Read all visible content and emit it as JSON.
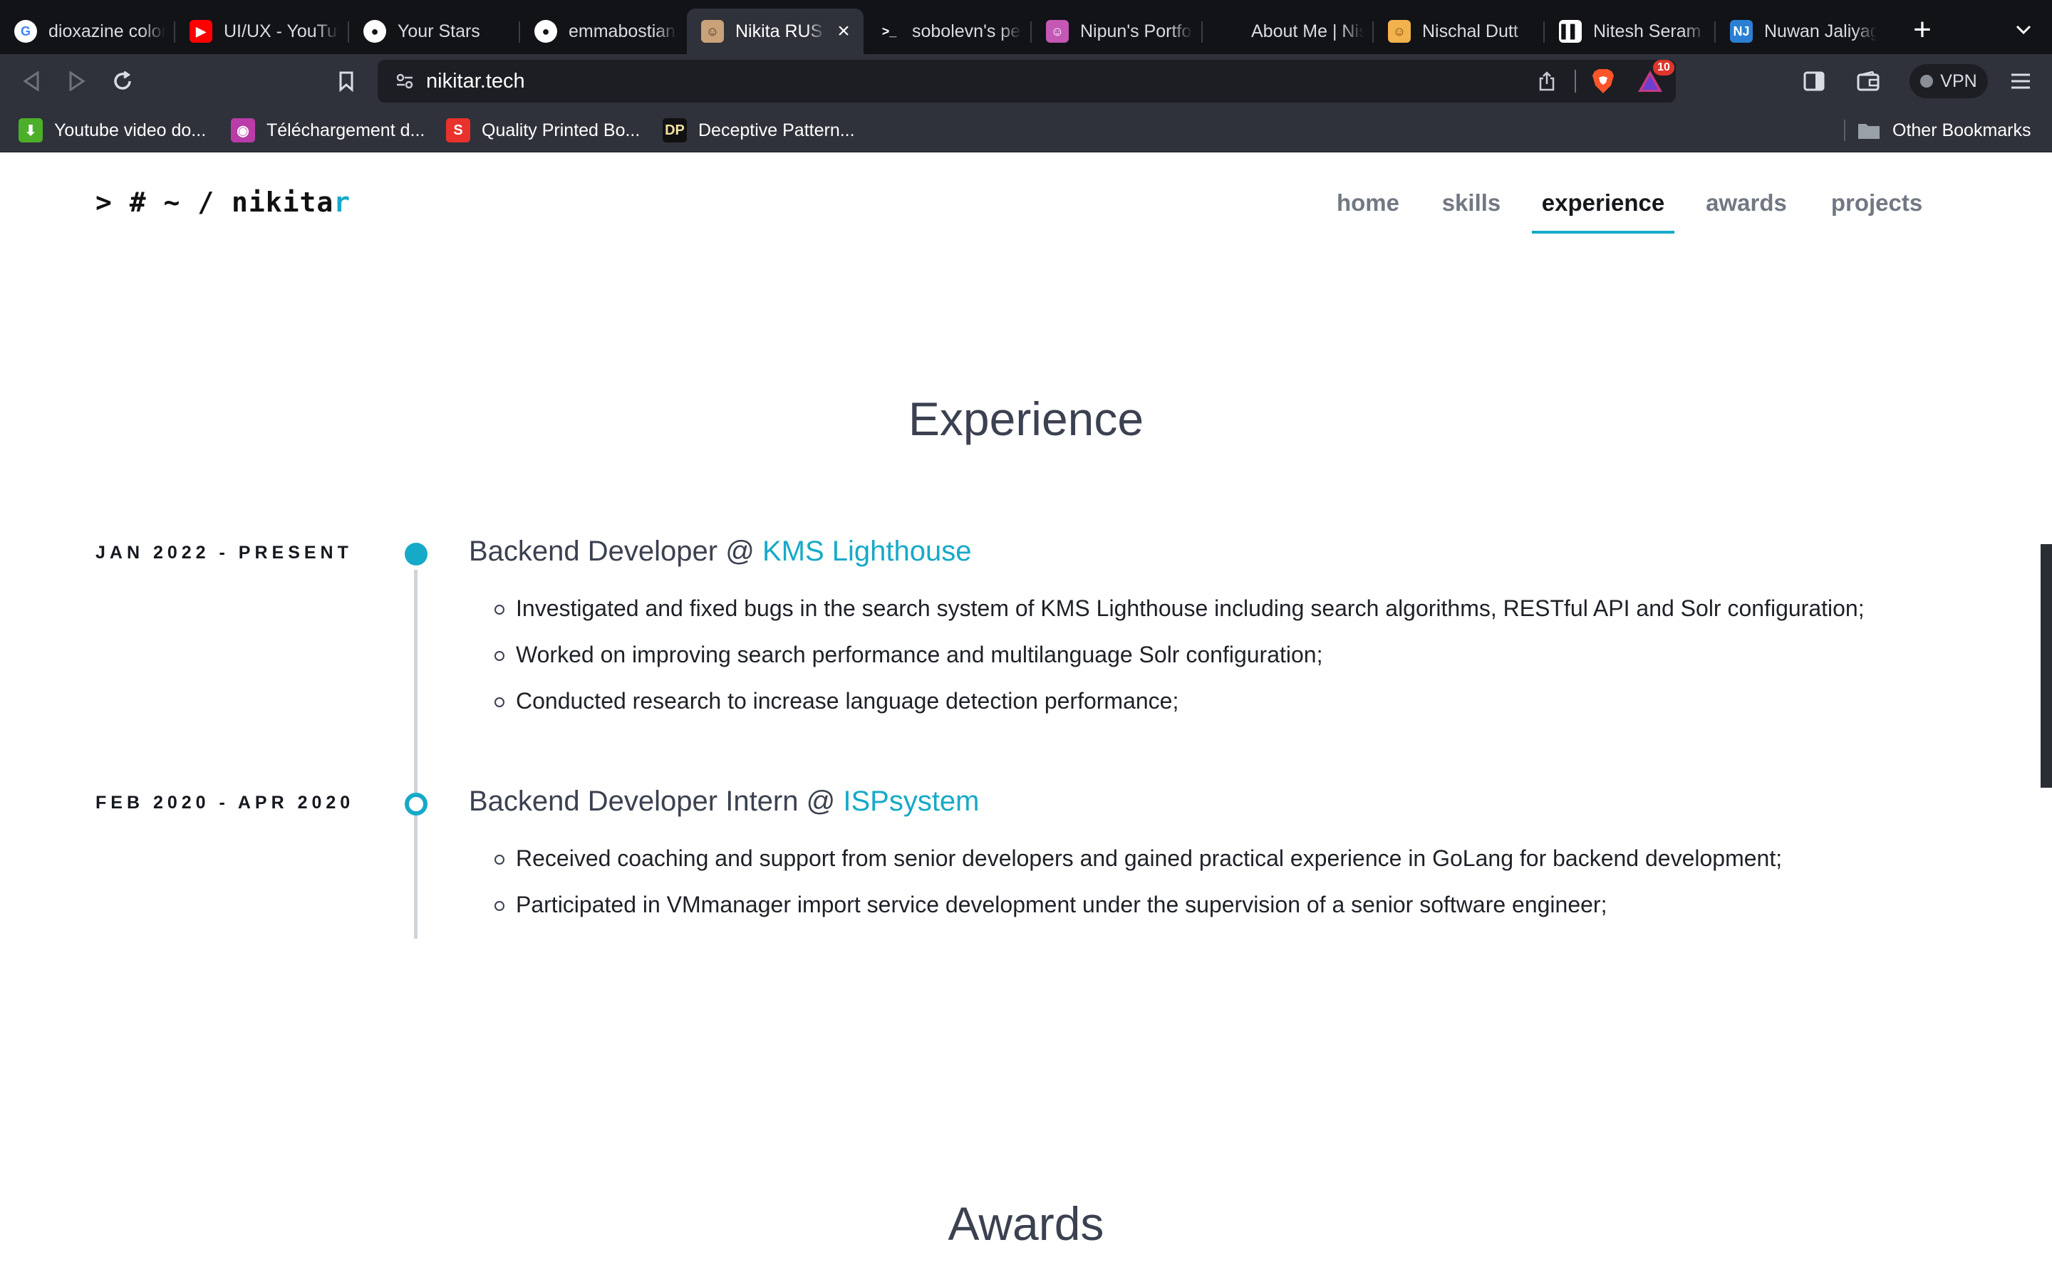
{
  "browser": {
    "tabs": [
      {
        "title": "dioxazine color",
        "favicon": "google-icon",
        "color": "#ffffff",
        "glyph": "G",
        "glyph_color": "#4285f4"
      },
      {
        "title": "UI/UX - YouTube",
        "favicon": "youtube-icon",
        "color": "#ff0000",
        "glyph": "▶",
        "glyph_color": "#ffffff"
      },
      {
        "title": "Your Stars",
        "favicon": "github-icon",
        "color": "#ffffff",
        "glyph": "●",
        "glyph_color": "#111317"
      },
      {
        "title": "emmabostian/developer-portfolios",
        "favicon": "github-icon",
        "color": "#ffffff",
        "glyph": "●",
        "glyph_color": "#111317"
      },
      {
        "title": "Nikita RUS",
        "favicon": "avatar-favicon",
        "color": "#c9a27a",
        "glyph": "☺",
        "glyph_color": "#4a3322",
        "active": true
      },
      {
        "title": "sobolevn's personal blog",
        "favicon": "terminal-icon",
        "color": "#111317",
        "glyph": ">_",
        "glyph_color": "#ffffff"
      },
      {
        "title": "Nipun's Portfolio",
        "favicon": "avatar-favicon",
        "color": "#c557b5",
        "glyph": "☺",
        "glyph_color": "#ffffff"
      },
      {
        "title": "About Me | Nisarg",
        "favicon": "blank-favicon",
        "color": "#111317",
        "glyph": "",
        "glyph_color": "#ffffff"
      },
      {
        "title": "Nischal Dutt",
        "favicon": "memoji-icon",
        "color": "#f2b24c",
        "glyph": "☺",
        "glyph_color": "#7a4a12"
      },
      {
        "title": "Nitesh Seram",
        "favicon": "book-icon",
        "color": "#ffffff",
        "glyph": "▌▌",
        "glyph_color": "#111317"
      },
      {
        "title": "Nuwan Jaliyagoda",
        "favicon": "nj-icon",
        "color": "#2a7fd4",
        "glyph": "NJ",
        "glyph_color": "#ffffff"
      }
    ],
    "url": "nikitar.tech",
    "rewards_badge": "10",
    "vpn_label": "VPN",
    "bookmarks": [
      {
        "label": "Youtube video do...",
        "icon": "download-arrow-icon",
        "color": "#4caf2a",
        "glyph": "⬇",
        "glyph_color": "#ffffff"
      },
      {
        "label": "Téléchargement d...",
        "icon": "app-icon",
        "color": "#b93ca8",
        "glyph": "◉",
        "glyph_color": "#ffffff"
      },
      {
        "label": "Quality Printed Bo...",
        "icon": "s-logo-icon",
        "color": "#e8322b",
        "glyph": "S",
        "glyph_color": "#ffffff"
      },
      {
        "label": "Deceptive Pattern...",
        "icon": "dp-logo-icon",
        "color": "#111111",
        "glyph": "DP",
        "glyph_color": "#f2e0a0"
      }
    ],
    "other_bookmarks": "Other Bookmarks"
  },
  "site": {
    "logo_text": "> # ~ / nikita",
    "logo_accent": "r",
    "accent_color": "#17a9c8",
    "nav": [
      {
        "label": "home",
        "active": false
      },
      {
        "label": "skills",
        "active": false
      },
      {
        "label": "experience",
        "active": true
      },
      {
        "label": "awards",
        "active": false
      },
      {
        "label": "projects",
        "active": false
      }
    ]
  },
  "experience": {
    "heading": "Experience",
    "jobs": [
      {
        "date": "JAN 2022 - PRESENT",
        "role": "Backend Developer @ ",
        "company": "KMS Lighthouse",
        "current": true,
        "bullets": [
          "Investigated and fixed bugs in the search system of KMS Lighthouse including search algorithms, RESTful API and Solr configuration;",
          "Worked on improving search performance and multilanguage Solr configuration;",
          "Conducted research to increase language detection performance;"
        ]
      },
      {
        "date": "FEB 2020 - APR 2020",
        "role": "Backend Developer Intern @ ",
        "company": "ISPsystem",
        "current": false,
        "bullets": [
          "Received coaching and support from senior developers and gained practical experience in GoLang for backend development;",
          "Participated in VMmanager import service development under the supervision of a senior software engineer;"
        ]
      }
    ]
  },
  "awards": {
    "heading": "Awards"
  }
}
